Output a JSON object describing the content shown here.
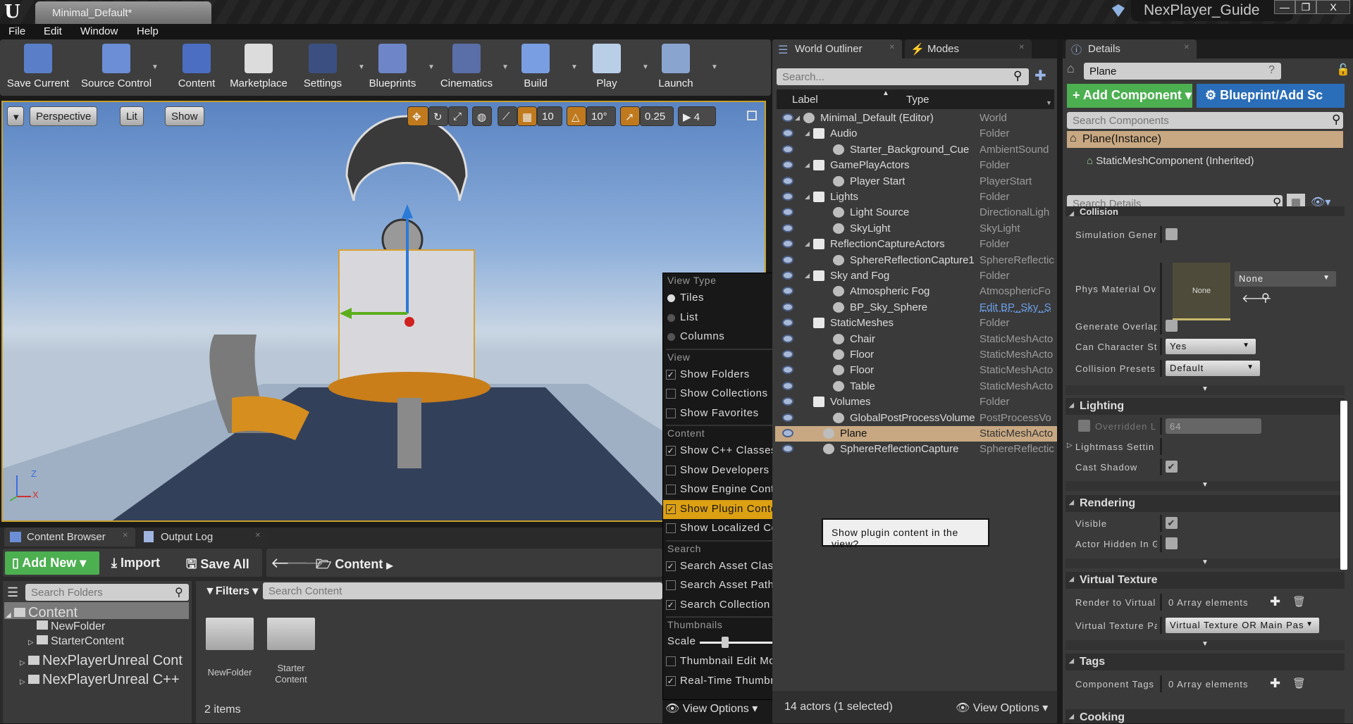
{
  "window": {
    "doc_tab": "Minimal_Default*",
    "project": "NexPlayer_Guide",
    "logo": "U"
  },
  "menubar": [
    "File",
    "Edit",
    "Window",
    "Help"
  ],
  "toolbar": [
    {
      "label": "Save Current",
      "icon": "save-icon",
      "color": "#5a7fc8"
    },
    {
      "label": "Source Control",
      "icon": "source-control-icon",
      "color": "#6b8ed6",
      "caret": true
    },
    {
      "label": "Content",
      "icon": "content-icon",
      "color": "#4b6ec2"
    },
    {
      "label": "Marketplace",
      "icon": "marketplace-icon",
      "color": "#dcdcdc"
    },
    {
      "label": "Settings",
      "icon": "settings-icon",
      "color": "#3b4f80",
      "caret": true
    },
    {
      "label": "Blueprints",
      "icon": "blueprints-icon",
      "color": "#6e86c8",
      "caret": true
    },
    {
      "label": "Cinematics",
      "icon": "cinematics-icon",
      "color": "#5a6ea8",
      "caret": true
    },
    {
      "label": "Build",
      "icon": "build-icon",
      "color": "#7a9ee2",
      "caret": true
    },
    {
      "label": "Play",
      "icon": "play-icon",
      "color": "#b9cfe8",
      "caret": true
    },
    {
      "label": "Launch",
      "icon": "launch-icon",
      "color": "#8aa4d0",
      "caret": true
    }
  ],
  "viewport": {
    "perspective": "Perspective",
    "lit": "Lit",
    "show": "Show",
    "grid_snap": "10",
    "rot_snap": "10°",
    "scale_snap": "0.25",
    "cam_speed": "4",
    "axis": {
      "z": "Z",
      "x": "X"
    }
  },
  "content_browser": {
    "tabs": [
      "Content Browser",
      "Output Log"
    ],
    "add_new": "Add New",
    "import": "Import",
    "save_all": "Save All",
    "path": "Content",
    "search_folders": "Search Folders",
    "filters": "Filters",
    "search_content": "Search Content",
    "tree": [
      "Content",
      "NewFolder",
      "StarterContent",
      "NexPlayerUnreal Content",
      "NexPlayerUnreal C++ Cla"
    ],
    "assets": [
      "NewFolder",
      "Starter\nContent"
    ],
    "count": "2 items",
    "view_options": "View Options"
  },
  "view_menu": {
    "sections": [
      {
        "title": "View Type",
        "items": [
          {
            "label": "Tiles",
            "type": "radio",
            "checked": true
          },
          {
            "label": "List",
            "type": "radio",
            "checked": false
          },
          {
            "label": "Columns",
            "type": "radio",
            "checked": false
          }
        ]
      },
      {
        "title": "View",
        "items": [
          {
            "label": "Show Folders",
            "checked": true,
            "submenu": true
          },
          {
            "label": "Show Collections",
            "checked": false
          },
          {
            "label": "Show Favorites",
            "checked": false
          }
        ]
      },
      {
        "title": "Content",
        "items": [
          {
            "label": "Show C++ Classes",
            "checked": true
          },
          {
            "label": "Show Developers Content",
            "checked": false
          },
          {
            "label": "Show Engine Content",
            "checked": false
          },
          {
            "label": "Show Plugin Content",
            "checked": true,
            "highlighted": true
          },
          {
            "label": "Show Localized Content",
            "checked": false
          }
        ]
      },
      {
        "title": "Search",
        "items": [
          {
            "label": "Search Asset Class Names",
            "checked": true
          },
          {
            "label": "Search Asset Path",
            "checked": false
          },
          {
            "label": "Search Collection Names",
            "checked": true
          }
        ]
      },
      {
        "title": "Thumbnails",
        "items": [
          {
            "label": "Scale",
            "type": "slider",
            "value": 0.2
          },
          {
            "label": "Thumbnail Edit Mode",
            "checked": false
          },
          {
            "label": "Real-Time Thumbnails",
            "checked": true
          }
        ]
      }
    ],
    "tooltip": "Show plugin content in the view?"
  },
  "outliner": {
    "tabs": [
      "World Outliner",
      "Modes"
    ],
    "search_placeholder": "Search...",
    "col_label": "Label",
    "col_type": "Type",
    "rows": [
      {
        "label": "Minimal_Default (Editor)",
        "type": "World",
        "depth": 0,
        "folder": false,
        "expand": true
      },
      {
        "label": "Audio",
        "type": "Folder",
        "depth": 1,
        "folder": true,
        "expand": true
      },
      {
        "label": "Starter_Background_Cue",
        "type": "AmbientSound",
        "depth": 2
      },
      {
        "label": "GamePlayActors",
        "type": "Folder",
        "depth": 1,
        "folder": true,
        "expand": true
      },
      {
        "label": "Player Start",
        "type": "PlayerStart",
        "depth": 2
      },
      {
        "label": "Lights",
        "type": "Folder",
        "depth": 1,
        "folder": true,
        "expand": true
      },
      {
        "label": "Light Source",
        "type": "DirectionalLigh",
        "depth": 2
      },
      {
        "label": "SkyLight",
        "type": "SkyLight",
        "depth": 2
      },
      {
        "label": "ReflectionCaptureActors",
        "type": "Folder",
        "depth": 1,
        "folder": true,
        "expand": true
      },
      {
        "label": "SphereReflectionCapture1",
        "type": "SphereReflectic",
        "depth": 2
      },
      {
        "label": "Sky and Fog",
        "type": "Folder",
        "depth": 1,
        "folder": true,
        "expand": true
      },
      {
        "label": "Atmospheric Fog",
        "type": "AtmosphericFo",
        "depth": 2
      },
      {
        "label": "BP_Sky_Sphere",
        "type": "Edit BP_Sky_S",
        "depth": 2,
        "link": true
      },
      {
        "label": "StaticMeshes",
        "type": "Folder",
        "depth": 1,
        "folder": true
      },
      {
        "label": "Chair",
        "type": "StaticMeshActo",
        "depth": 2
      },
      {
        "label": "Floor",
        "type": "StaticMeshActo",
        "depth": 2
      },
      {
        "label": "Floor",
        "type": "StaticMeshActo",
        "depth": 2
      },
      {
        "label": "Table",
        "type": "StaticMeshActo",
        "depth": 2
      },
      {
        "label": "Volumes",
        "type": "Folder",
        "depth": 1,
        "folder": true
      },
      {
        "label": "GlobalPostProcessVolume",
        "type": "PostProcessVo",
        "depth": 2
      },
      {
        "label": "Plane",
        "type": "StaticMeshActo",
        "depth": 1,
        "selected": true
      },
      {
        "label": "SphereReflectionCapture",
        "type": "SphereReflectic",
        "depth": 1
      }
    ],
    "status": "14 actors (1 selected)",
    "view_options": "View Options"
  },
  "details": {
    "tab": "Details",
    "name": "Plane",
    "add_component": "Add Component",
    "blueprint": "Blueprint/Add Sc",
    "search_components": "Search Components",
    "instance": "Plane(Instance)",
    "component": "StaticMeshComponent (Inherited)",
    "search_details": "Search Details",
    "sections": {
      "collision": "Collision",
      "lighting": "Lighting",
      "rendering": "Rendering",
      "virtual_texture": "Virtual Texture",
      "tags": "Tags",
      "cooking": "Cooking"
    },
    "props": {
      "sim_gen": "Simulation Genera",
      "phys_mat": "Phys Material Ov",
      "phys_mat_thumb": "None",
      "phys_mat_value": "None",
      "gen_overlap": "Generate Overlap",
      "can_char": "Can Character Ste",
      "can_char_value": "Yes",
      "presets": "Collision Presets",
      "presets_value": "Default",
      "overridden": "Overridden Li",
      "overridden_value": "64",
      "lightmass": "Lightmass Settin",
      "cast_shadow": "Cast Shadow",
      "visible": "Visible",
      "hidden": "Actor Hidden In G",
      "render_vt": "Render to Virtual",
      "render_vt_value": "0 Array elements",
      "vt_pass": "Virtual Texture Pa",
      "vt_pass_value": "Virtual Texture OR Main Pas",
      "comp_tags": "Component Tags",
      "comp_tags_value": "0 Array elements"
    },
    "checks": {
      "sim_gen": false,
      "gen_overlap": false,
      "overridden": false,
      "cast_shadow": true,
      "visible": true,
      "hidden": false
    }
  },
  "colors": {
    "accent": "#dca013",
    "selection": "#c8a882",
    "add_green": "#4caf50",
    "blueprint_blue": "#2a6db8"
  }
}
